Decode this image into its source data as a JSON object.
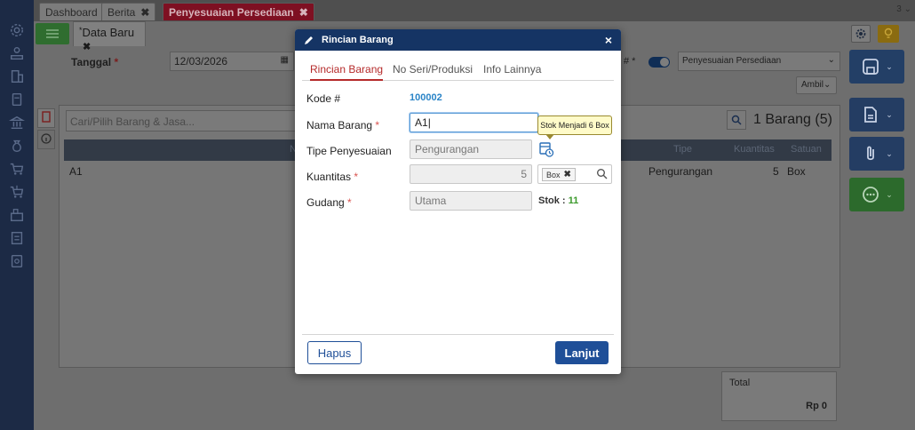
{
  "tabs": {
    "items": [
      {
        "label": "Dashboard"
      },
      {
        "label": "Berita",
        "close": "✖"
      },
      {
        "label": "Penyesuaian Persediaan",
        "close": "✖"
      }
    ],
    "count": "3 ⌄"
  },
  "subtab": {
    "star": "*",
    "label": "Data Baru",
    "close": "✖"
  },
  "form": {
    "tanggal_label": "Tanggal",
    "required_mark": "*",
    "tanggal_value": "12/03/2026",
    "toggle_label_tail": "# *",
    "type_value": "Penyesuaian Persediaan",
    "ambil_label": "Ambil",
    "ambil_caret": "⌄",
    "search_placeholder": "Cari/Pilih Barang & Jasa...",
    "count_text": "1 Barang (5)"
  },
  "grid": {
    "columns": {
      "name": "N",
      "tipe": "Tipe",
      "kuantitas": "Kuantitas",
      "satuan": "Satuan"
    },
    "rows": [
      {
        "name": "A1",
        "tipe": "Pengurangan",
        "kuantitas": "5",
        "satuan": "Box"
      }
    ]
  },
  "total": {
    "label": "Total",
    "value": "Rp 0"
  },
  "modal": {
    "title": "Rincian Barang",
    "close": "×",
    "tabs": [
      "Rincian Barang",
      "No Seri/Produksi",
      "Info Lainnya"
    ],
    "fields": {
      "kode_label": "Kode #",
      "kode_value": "100002",
      "nama_label": "Nama Barang",
      "nama_value": "A1",
      "tipe_label": "Tipe Penyesuaian",
      "tipe_value": "Pengurangan",
      "kuantitas_label": "Kuantitas",
      "kuantitas_value": "5",
      "unit_value": "Box",
      "unit_remove": "✖",
      "gudang_label": "Gudang",
      "gudang_value": "Utama",
      "stok_label": "Stok :",
      "stok_value": "11",
      "tooltip": "Stok Menjadi 6 Box"
    },
    "buttons": {
      "hapus": "Hapus",
      "lanjut": "Lanjut"
    }
  },
  "colors": {
    "accent_red": "#b52a2a",
    "primary_blue": "#1f4f98",
    "header_navy": "#153464",
    "stock_green": "#3c9a2c",
    "link_blue": "#2a84c7"
  }
}
